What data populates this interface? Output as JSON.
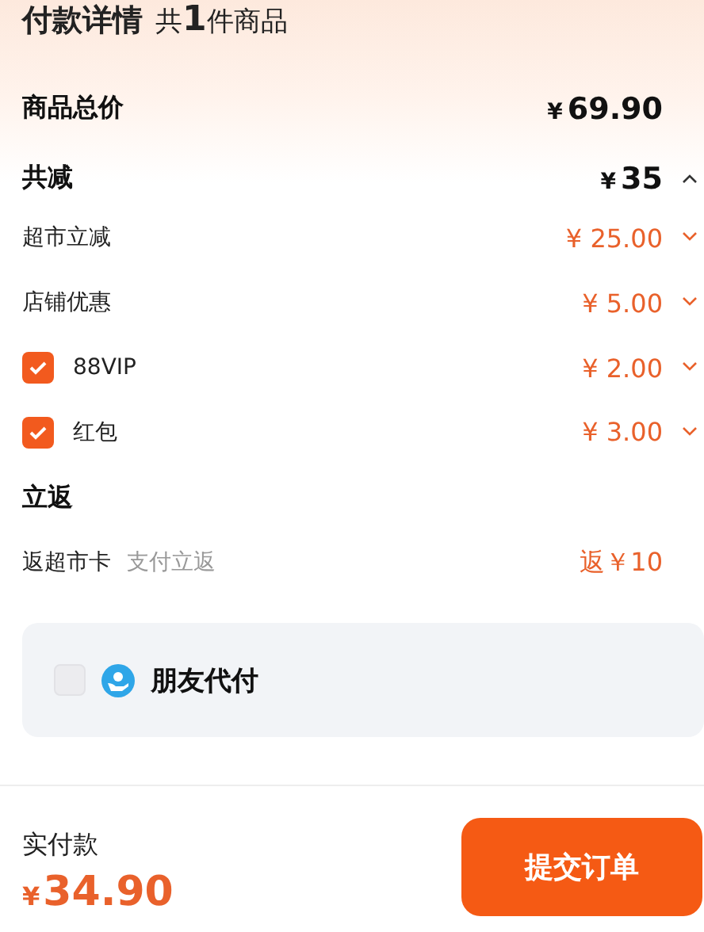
{
  "header": {
    "title": "付款详情",
    "count_prefix": "共",
    "count": "1",
    "count_suffix": "件商品"
  },
  "total": {
    "label": "商品总价",
    "currency": "¥",
    "amount": "69.90"
  },
  "discount": {
    "label": "共减",
    "currency": "¥",
    "amount": "35",
    "expanded": true
  },
  "discount_items": [
    {
      "kind": "plain",
      "label": "超市立减",
      "amount": "¥ 25.00"
    },
    {
      "kind": "plain",
      "label": "店铺优惠",
      "amount": "¥ 5.00"
    },
    {
      "kind": "checkbox",
      "label": "88VIP",
      "amount": "¥ 2.00",
      "checked": true
    },
    {
      "kind": "checkbox",
      "label": "红包",
      "amount": "¥ 3.00",
      "checked": true
    }
  ],
  "rebate": {
    "title": "立返",
    "label": "返超市卡",
    "note": "支付立返",
    "amount": "返￥10"
  },
  "friend_pay": {
    "label": "朋友代付",
    "checked": false
  },
  "footer": {
    "label": "实付款",
    "currency": "¥",
    "amount": "34.90",
    "button": "提交订单"
  }
}
